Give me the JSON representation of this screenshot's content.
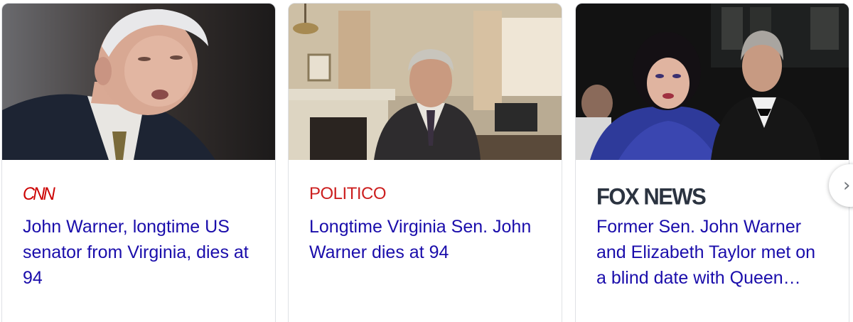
{
  "cards": [
    {
      "source": "CNN",
      "headline": "John Warner, longtime US senator from Virginia, dies at 94"
    },
    {
      "source": "POLITICO",
      "headline": "Longtime Virginia Sen. John Warner dies at 94"
    },
    {
      "source": "FOX NEWS",
      "headline": "Former Sen. John Warner and Elizabeth Taylor met on a blind date with Queen…"
    }
  ],
  "next_icon": "chevron-right-icon",
  "colors": {
    "link": "#1a0dab",
    "cnn": "#cc0000",
    "politico": "#cc1f1f",
    "fox": "#2b3340",
    "border": "#dfe1e5"
  }
}
